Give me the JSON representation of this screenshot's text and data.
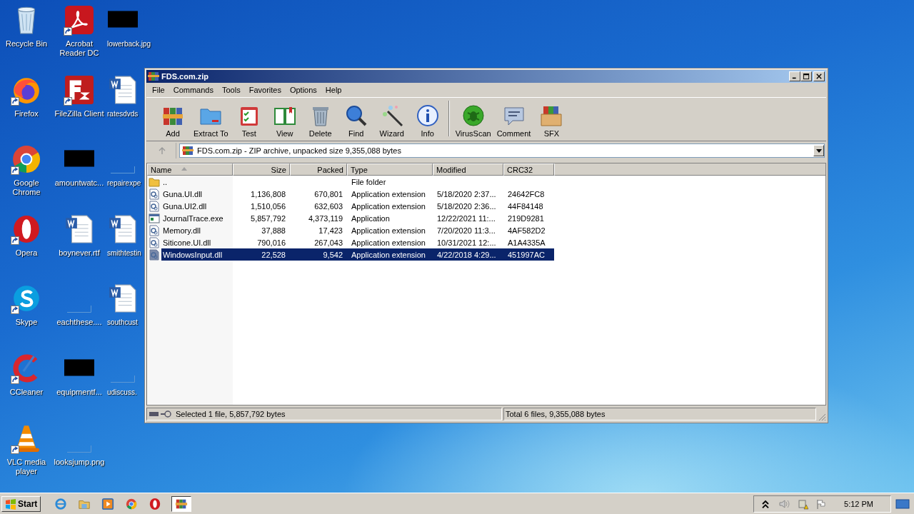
{
  "desktop": {
    "columns": [
      [
        {
          "kind": "recycle",
          "label": "Recycle Bin",
          "shortcut": false
        },
        {
          "kind": "firefox",
          "label": "Firefox",
          "shortcut": true
        },
        {
          "kind": "chrome",
          "label": "Google Chrome",
          "shortcut": true
        },
        {
          "kind": "opera",
          "label": "Opera",
          "shortcut": true
        },
        {
          "kind": "skype",
          "label": "Skype",
          "shortcut": true
        },
        {
          "kind": "ccleaner",
          "label": "CCleaner",
          "shortcut": true
        },
        {
          "kind": "vlc",
          "label": "VLC media player",
          "shortcut": true
        }
      ],
      [
        {
          "kind": "acrobat",
          "label": "Acrobat Reader DC",
          "shortcut": true
        },
        {
          "kind": "filezilla",
          "label": "FileZilla Client",
          "shortcut": true
        },
        {
          "kind": "redacted",
          "label": "amountwatc...",
          "shortcut": false
        },
        {
          "kind": "word",
          "label": "boynever.rtf",
          "shortcut": false
        },
        {
          "kind": "blank",
          "label": "eachthese....",
          "shortcut": false
        },
        {
          "kind": "redacted",
          "label": "equipmentf...",
          "shortcut": false
        },
        {
          "kind": "blank",
          "label": "looksjump.png",
          "shortcut": false
        }
      ],
      [
        {
          "kind": "redacted",
          "label": "lowerback.jpg",
          "shortcut": false
        },
        {
          "kind": "word",
          "label": "ratesdvds",
          "shortcut": false
        },
        {
          "kind": "blank",
          "label": "repairexpe",
          "shortcut": false
        },
        {
          "kind": "word",
          "label": "smithtestin",
          "shortcut": false
        },
        {
          "kind": "word",
          "label": "southcust",
          "shortcut": false
        },
        {
          "kind": "blank",
          "label": "udiscuss.",
          "shortcut": false
        }
      ]
    ]
  },
  "window": {
    "title": "FDS.com.zip",
    "menu": [
      "File",
      "Commands",
      "Tools",
      "Favorites",
      "Options",
      "Help"
    ],
    "toolbar_groups": [
      [
        {
          "kind": "add",
          "label": "Add"
        },
        {
          "kind": "extract",
          "label": "Extract To"
        },
        {
          "kind": "test",
          "label": "Test"
        },
        {
          "kind": "view",
          "label": "View"
        },
        {
          "kind": "delete",
          "label": "Delete"
        },
        {
          "kind": "find",
          "label": "Find"
        },
        {
          "kind": "wizard",
          "label": "Wizard"
        },
        {
          "kind": "info",
          "label": "Info"
        }
      ],
      [
        {
          "kind": "virusscan",
          "label": "VirusScan"
        },
        {
          "kind": "comment",
          "label": "Comment"
        },
        {
          "kind": "sfx",
          "label": "SFX"
        }
      ]
    ],
    "address": "FDS.com.zip - ZIP archive, unpacked size 9,355,088 bytes",
    "table": {
      "columns": [
        {
          "label": "Name",
          "sorted": true
        },
        {
          "label": "Size",
          "sorted": false
        },
        {
          "label": "Packed",
          "sorted": false
        },
        {
          "label": "Type",
          "sorted": false
        },
        {
          "label": "Modified",
          "sorted": false
        },
        {
          "label": "CRC32",
          "sorted": false
        }
      ],
      "rows": [
        {
          "kind": "folder",
          "cells": [
            "..",
            "",
            "",
            "File folder",
            "",
            ""
          ],
          "selected": false
        },
        {
          "kind": "dll",
          "cells": [
            "Guna.UI.dll",
            "1,136,808",
            "670,801",
            "Application extension",
            "5/18/2020 2:37...",
            "24642FC8"
          ],
          "selected": false
        },
        {
          "kind": "dll",
          "cells": [
            "Guna.UI2.dll",
            "1,510,056",
            "632,603",
            "Application extension",
            "5/18/2020 2:36...",
            "44F84148"
          ],
          "selected": false
        },
        {
          "kind": "exe",
          "cells": [
            "JournalTrace.exe",
            "5,857,792",
            "4,373,119",
            "Application",
            "12/22/2021 11:...",
            "219D9281"
          ],
          "selected": false
        },
        {
          "kind": "dll",
          "cells": [
            "Memory.dll",
            "37,888",
            "17,423",
            "Application extension",
            "7/20/2020 11:3...",
            "4AF582D2"
          ],
          "selected": false
        },
        {
          "kind": "dll",
          "cells": [
            "Siticone.UI.dll",
            "790,016",
            "267,043",
            "Application extension",
            "10/31/2021 12:...",
            "A1A4335A"
          ],
          "selected": false
        },
        {
          "kind": "dll",
          "cells": [
            "WindowsInput.dll",
            "22,528",
            "9,542",
            "Application extension",
            "4/22/2018 4:29...",
            "451997AC"
          ],
          "selected": true
        }
      ]
    },
    "status_left": "Selected 1 file, 5,857,792 bytes",
    "status_right": "Total 6 files, 9,355,088 bytes"
  },
  "taskbar": {
    "start": "Start",
    "apps": [
      {
        "kind": "ie",
        "active": false
      },
      {
        "kind": "explorer",
        "active": false
      },
      {
        "kind": "media",
        "active": false
      },
      {
        "kind": "chrome",
        "active": false
      },
      {
        "kind": "opera",
        "active": false
      },
      {
        "kind": "winrar",
        "active": true
      }
    ],
    "clock": "5:12 PM"
  }
}
